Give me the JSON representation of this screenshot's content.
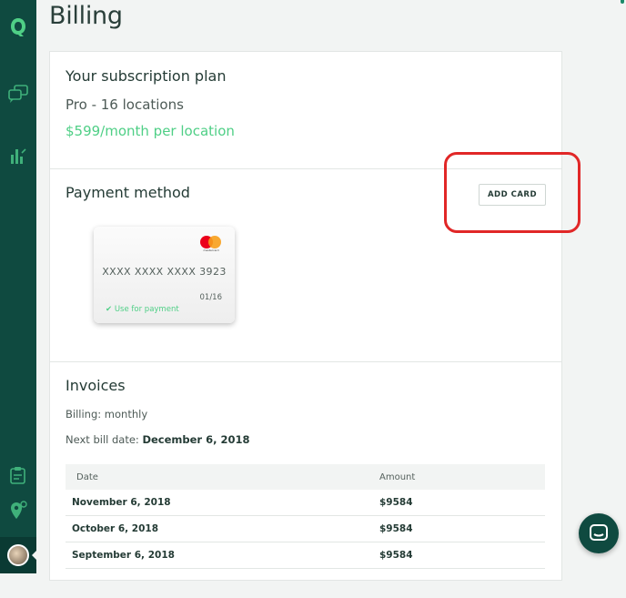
{
  "page": {
    "title": "Billing"
  },
  "sidebar": {
    "icons": [
      "logo-icon",
      "chat-bubble-icon",
      "analytics-icon",
      "clipboard-icon",
      "location-pin-icon"
    ],
    "user": "avatar"
  },
  "subscription": {
    "heading": "Your subscription plan",
    "plan": "Pro - 16 locations",
    "price": "$599/month per location"
  },
  "payment": {
    "heading": "Payment method",
    "add_card_label": "ADD CARD",
    "card": {
      "brand": "mastercard",
      "number": "XXXX XXXX XXXX 3923",
      "expiry": "01/16",
      "status": "Use for payment"
    }
  },
  "invoices": {
    "heading": "Invoices",
    "billing_label": "Billing:",
    "billing_value": "monthly",
    "next_label": "Next bill date:",
    "next_value": "December 6, 2018",
    "columns": [
      "Date",
      "Amount"
    ],
    "rows": [
      {
        "date": "November 6, 2018",
        "amount": "$9584"
      },
      {
        "date": "October 6, 2018",
        "amount": "$9584"
      },
      {
        "date": "September 6, 2018",
        "amount": "$9584"
      }
    ]
  },
  "colors": {
    "sidebar": "#0f4a40",
    "accent_green": "#4fcf86",
    "highlight": "#e12727"
  }
}
